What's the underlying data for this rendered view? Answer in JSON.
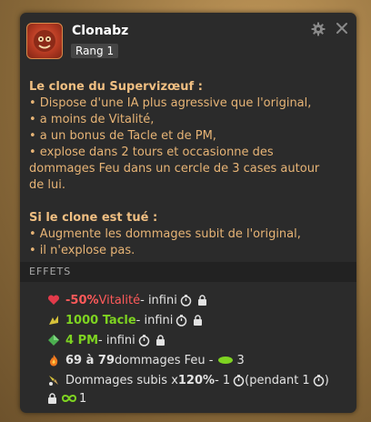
{
  "header": {
    "name": "Clonabz",
    "rank": "Rang 1"
  },
  "description": {
    "title1": "Le clone du Supervizœuf :",
    "lines1": [
      "• Dispose d'une IA plus agressive que l'original,",
      "• a moins de Vitalité,",
      "• a un bonus de Tacle et de PM,",
      "• explose dans 2 tours et occasionne des",
      "dommages Feu dans un cercle de 3 cases autour",
      "de lui."
    ],
    "title2": "Si le clone est tué :",
    "lines2": [
      "• Augmente les dommages subit de l'original,",
      "• il n'explose pas."
    ]
  },
  "effets_label": "EFFETS",
  "effects": [
    {
      "value": "-50%",
      "stat": " Vitalité",
      "duration": " - infini"
    },
    {
      "value": "1000 Tacle",
      "duration": " - infini"
    },
    {
      "value": "4 PM",
      "duration": " - infini"
    },
    {
      "range": "69 à 79",
      "text": " dommages Feu - ",
      "area": "3"
    },
    {
      "text": "Dommages subis x",
      "mult": "120%",
      "duration": " - 1",
      "extra": " (pendant 1",
      "extra_end": ")",
      "line2": "1"
    }
  ],
  "colors": {
    "panel": "#2b2b2b",
    "desc_text": "#e7b476",
    "negative": "#ff5a5a",
    "positive": "#7ed321"
  }
}
